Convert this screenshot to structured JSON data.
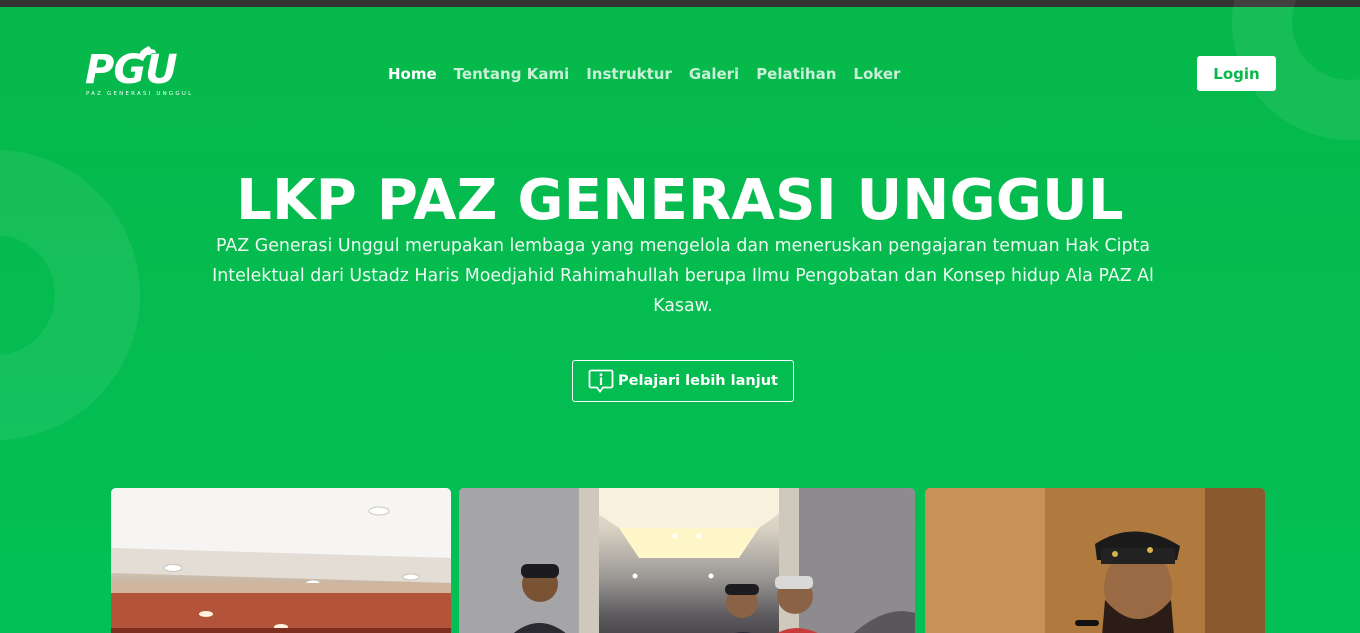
{
  "header": {
    "logo_text": "PGU",
    "logo_subtitle": "PAZ GENERASI UNGGUL",
    "nav": [
      {
        "label": "Home",
        "active": true
      },
      {
        "label": "Tentang Kami",
        "active": false
      },
      {
        "label": "Instruktur",
        "active": false
      },
      {
        "label": "Galeri",
        "active": false
      },
      {
        "label": "Pelatihan",
        "active": false
      },
      {
        "label": "Loker",
        "active": false
      }
    ],
    "login_label": "Login"
  },
  "hero": {
    "title": "LKP PAZ GENERASI UNGGUL",
    "description": "PAZ Generasi Unggul merupakan lembaga yang mengelola dan meneruskan pengajaran temuan Hak Cipta Intelektual dari Ustadz Haris Moedjahid Rahimahullah berupa Ilmu Pengobatan dan Konsep hidup Ala PAZ Al Kasaw.",
    "cta_label": "Pelajari lebih lanjut",
    "cta_icon": "info-icon"
  },
  "gallery": {
    "photos": [
      {
        "name": "ceiling-lights-room"
      },
      {
        "name": "group-in-office-hallway"
      },
      {
        "name": "speaker-with-microphone"
      }
    ]
  },
  "colors": {
    "primary_green": "#06b84a",
    "topbar": "#333333",
    "white": "#ffffff"
  }
}
